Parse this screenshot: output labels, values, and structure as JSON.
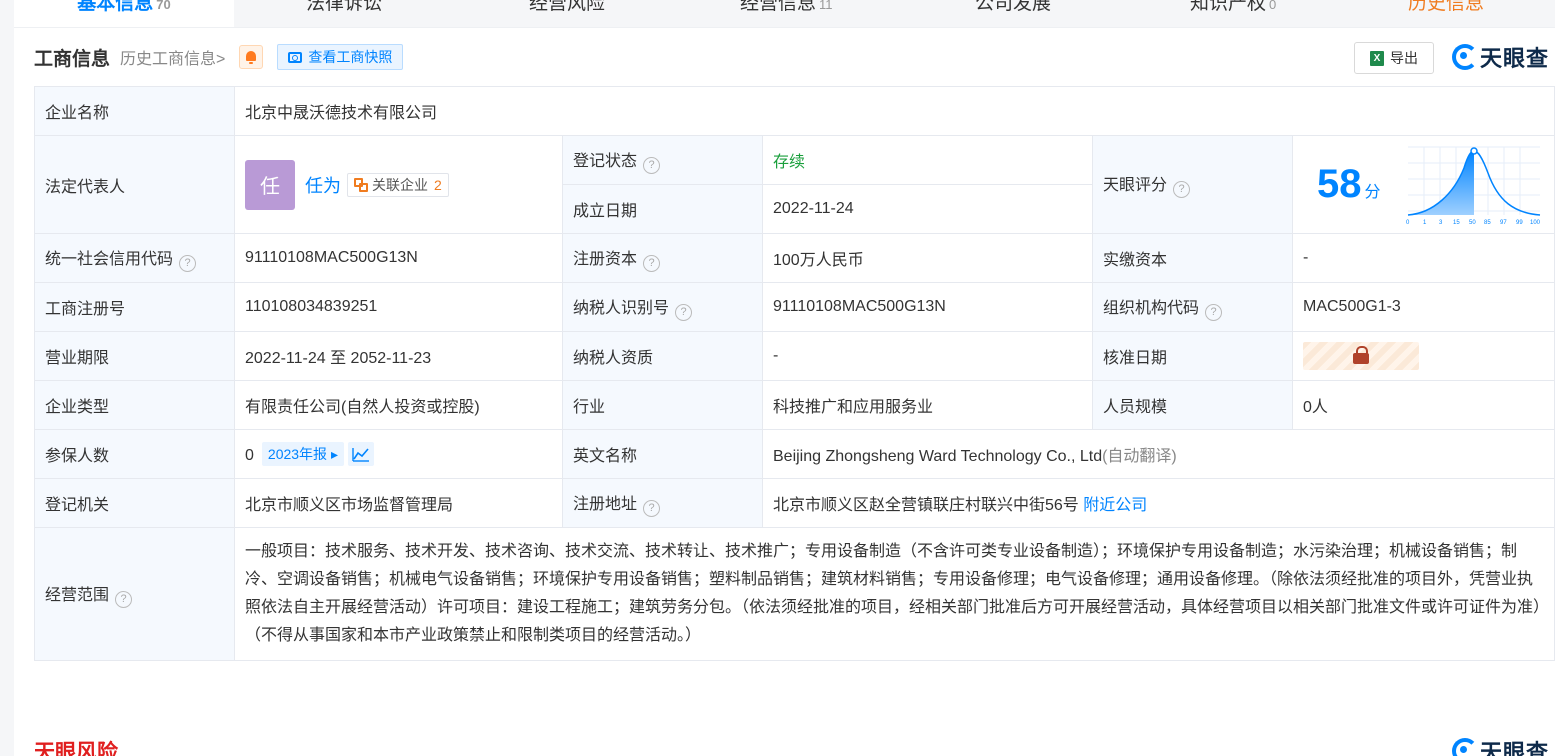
{
  "tabs": [
    {
      "label": "基本信息",
      "count": "70"
    },
    {
      "label": "法律诉讼",
      "count": ""
    },
    {
      "label": "经营风险",
      "count": ""
    },
    {
      "label": "经营信息",
      "count": "11"
    },
    {
      "label": "公司发展",
      "count": ""
    },
    {
      "label": "知识产权",
      "count": "0"
    },
    {
      "label": "历史信息",
      "count": ""
    }
  ],
  "header": {
    "title": "工商信息",
    "history_link": "历史工商信息>",
    "snapshot_label": "查看工商快照",
    "export_label": "导出",
    "logo_text": "天眼查"
  },
  "company": {
    "name_label": "企业名称",
    "name": "北京中晟沃德技术有限公司",
    "legal_rep_label": "法定代表人",
    "legal_rep_avatar": "任",
    "legal_rep_name": "任为",
    "related_label": "关联企业",
    "related_count": "2",
    "reg_status_label": "登记状态",
    "reg_status": "存续",
    "found_date_label": "成立日期",
    "found_date": "2022-11-24",
    "score_label": "天眼评分",
    "score": "58",
    "score_unit": "分",
    "score_axis": [
      "0",
      "1",
      "3",
      "15",
      "50",
      "85",
      "97",
      "99",
      "100"
    ],
    "credit_code_label": "统一社会信用代码",
    "credit_code": "91110108MAC500G13N",
    "reg_capital_label": "注册资本",
    "reg_capital": "100万人民币",
    "paid_capital_label": "实缴资本",
    "paid_capital": "-",
    "biz_reg_no_label": "工商注册号",
    "biz_reg_no": "110108034839251",
    "taxpayer_id_label": "纳税人识别号",
    "taxpayer_id": "91110108MAC500G13N",
    "org_code_label": "组织机构代码",
    "org_code": "MAC500G1-3",
    "term_label": "营业期限",
    "term": "2022-11-24 至 2052-11-23",
    "taxpayer_qual_label": "纳税人资质",
    "taxpayer_qual": "-",
    "approve_date_label": "核准日期",
    "type_label": "企业类型",
    "type": "有限责任公司(自然人投资或控股)",
    "industry_label": "行业",
    "industry": "科技推广和应用服务业",
    "staff_label": "人员规模",
    "staff": "0人",
    "insured_label": "参保人数",
    "insured": "0",
    "insured_year": "2023年报",
    "english_label": "英文名称",
    "english_name": "Beijing Zhongsheng Ward Technology Co., Ltd",
    "english_note": "(自动翻译)",
    "authority_label": "登记机关",
    "authority": "北京市顺义区市场监督管理局",
    "address_label": "注册地址",
    "address": "北京市顺义区赵全营镇联庄村联兴中街56号",
    "nearby_label": "附近公司",
    "scope_label": "经营范围",
    "scope": "一般项目：技术服务、技术开发、技术咨询、技术交流、技术转让、技术推广；专用设备制造（不含许可类专业设备制造）；环境保护专用设备制造；水污染治理；机械设备销售；制冷、空调设备销售；机械电气设备销售；环境保护专用设备销售；塑料制品销售；建筑材料销售；专用设备修理；电气设备修理；通用设备修理。（除依法须经批准的项目外，凭营业执照依法自主开展经营活动）许可项目：建设工程施工；建筑劳务分包。（依法须经批准的项目，经相关部门批准后方可开展经营活动，具体经营项目以相关部门批准文件或许可证件为准）（不得从事国家和本市产业政策禁止和限制类项目的经营活动。）"
  },
  "next_section": {
    "title": "天眼风险",
    "logo_text": "天眼查"
  }
}
